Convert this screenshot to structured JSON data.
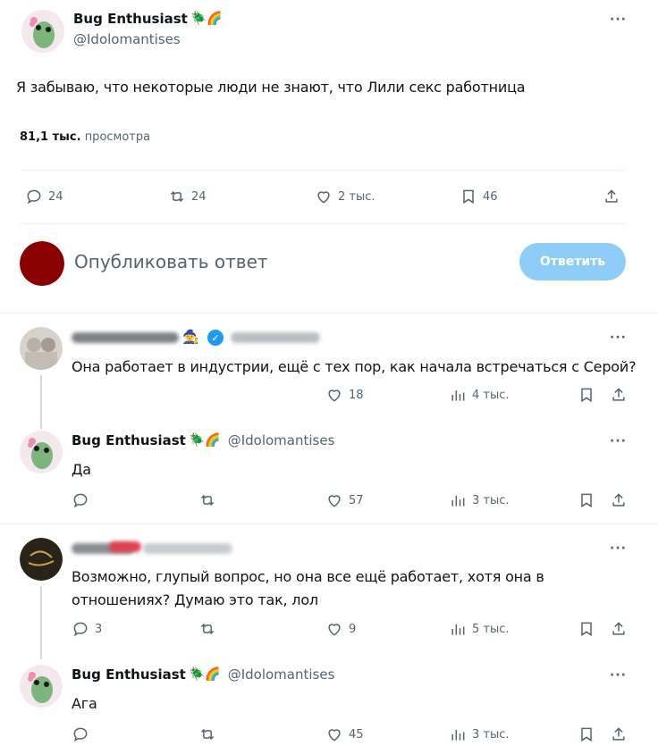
{
  "main_tweet": {
    "author_name": "Bug Enthusiast",
    "author_emoji": "🪲🌈",
    "author_handle": "@Idolomantises",
    "text": "Я забываю, что некоторые люди не знают, что Лили секс работница",
    "views_count": "81,1 тыс.",
    "views_label": "просмотра",
    "replies": "24",
    "reposts": "24",
    "likes": "2 тыс.",
    "bookmarks": "46"
  },
  "compose": {
    "placeholder": "Опубликовать ответ",
    "reply_button": "Ответить"
  },
  "replies": [
    {
      "author_emoji": "🧙",
      "text": "Она работает в индустрии, ещё с тех пор, как начала встречаться с Серой?",
      "likes": "18",
      "views": "4 тыс."
    },
    {
      "author_name": "Bug Enthusiast",
      "author_emoji": "🪲🌈",
      "author_handle": "@Idolomantises",
      "text": "Да",
      "likes": "57",
      "views": "3 тыс."
    },
    {
      "text": "Возможно, глупый вопрос, но она все ещё работает, хотя она в отношениях? Думаю это так, лол",
      "replies": "3",
      "likes": "9",
      "views": "5 тыс."
    },
    {
      "author_name": "Bug Enthusiast",
      "author_emoji": "🪲🌈",
      "author_handle": "@Idolomantises",
      "text": "Ага",
      "likes": "45",
      "views": "3 тыс."
    }
  ],
  "colors": {
    "accent": "#1d9bf0",
    "reply_button_disabled": "#8ecdf8",
    "avatar_green": "#7bb77a",
    "user_avatar": "#8b0000"
  }
}
